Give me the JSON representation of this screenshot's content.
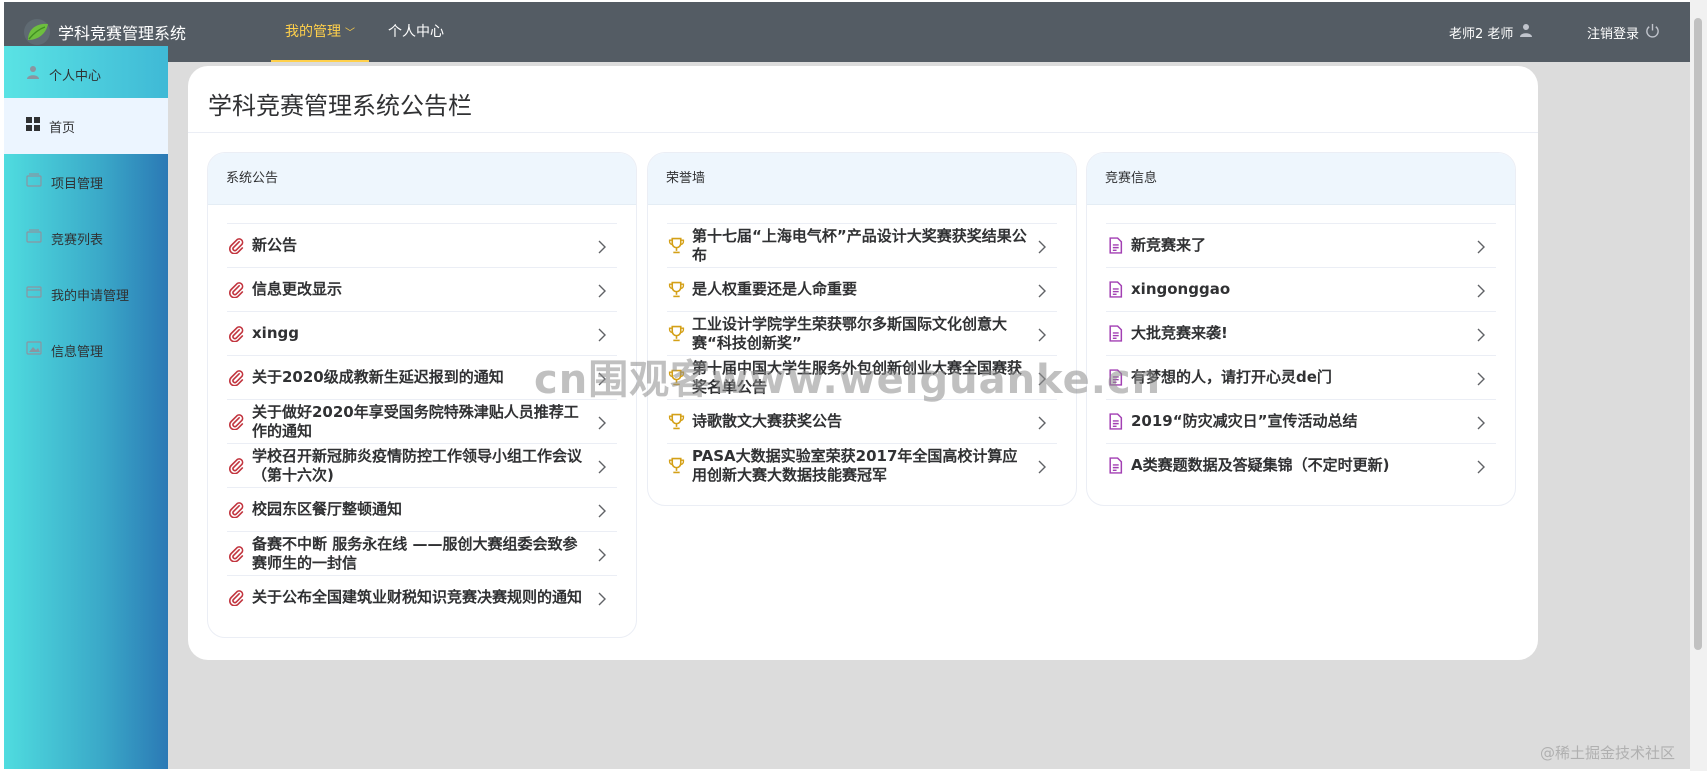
{
  "header": {
    "app_title": "学科竞赛管理系统",
    "logo_icon": "leaf-logo-icon",
    "nav": [
      {
        "label": "我的管理",
        "active": true,
        "has_dropdown": true
      },
      {
        "label": "个人中心",
        "active": false
      }
    ],
    "user_label": "老师2 老师",
    "user_icon": "user-icon",
    "logout_label": "注销登录",
    "logout_icon": "power-icon",
    "active_color": "#ffd04b",
    "bar_color": "#545c64"
  },
  "sidebar": {
    "items": [
      {
        "label": "个人中心",
        "icon": "user-icon"
      },
      {
        "label": "首页",
        "icon": "grid-icon",
        "active": true
      },
      {
        "label": "项目管理",
        "icon": "folder-icon"
      },
      {
        "label": "竞赛列表",
        "icon": "folder-icon"
      },
      {
        "label": "我的申请管理",
        "icon": "card-icon"
      },
      {
        "label": "信息管理",
        "icon": "image-icon"
      }
    ]
  },
  "main": {
    "title": "学科竞赛管理系统公告栏",
    "panels": [
      {
        "title": "系统公告",
        "icon": "paperclip-icon",
        "icon_color": "#c2353f",
        "items": [
          "新公告",
          "信息更改显示",
          "xingg",
          "关于2020级成教新生延迟报到的通知",
          "关于做好2020年享受国务院特殊津贴人员推荐工作的通知",
          "学校召开新冠肺炎疫情防控工作领导小组工作会议（第十六次)",
          "校园东区餐厅整顿通知",
          "备赛不中断 服务永在线 ——服创大赛组委会致参赛师生的一封信",
          "关于公布全国建筑业财税知识竞赛决赛规则的通知"
        ]
      },
      {
        "title": "荣誉墙",
        "icon": "trophy-icon",
        "icon_color": "#d4a017",
        "items": [
          "第十七届“上海电气杯”产品设计大奖赛获奖结果公布",
          "是人权重要还是人命重要",
          "工业设计学院学生荣获鄂尔多斯国际文化创意大赛“科技创新奖”",
          "第十届中国大学生服务外包创新创业大赛全国赛获奖名单公告",
          "诗歌散文大赛获奖公告",
          "PASA大数据实验室荣获2017年全国高校计算应用创新大赛大数据技能赛冠军"
        ]
      },
      {
        "title": "竞赛信息",
        "icon": "document-icon",
        "icon_color": "#a23fb3",
        "items": [
          "新竞赛来了",
          "xingonggao",
          "大批竞赛来袭!",
          "有梦想的人，请打开心灵de门",
          "2019“防灾减灾日”宣传活动总结",
          "A类赛题数据及答疑集锦（不定时更新)"
        ]
      }
    ]
  },
  "watermarks": {
    "center": "cn围观客www.weiguanke.cn",
    "corner": "@稀土掘金技术社区"
  }
}
